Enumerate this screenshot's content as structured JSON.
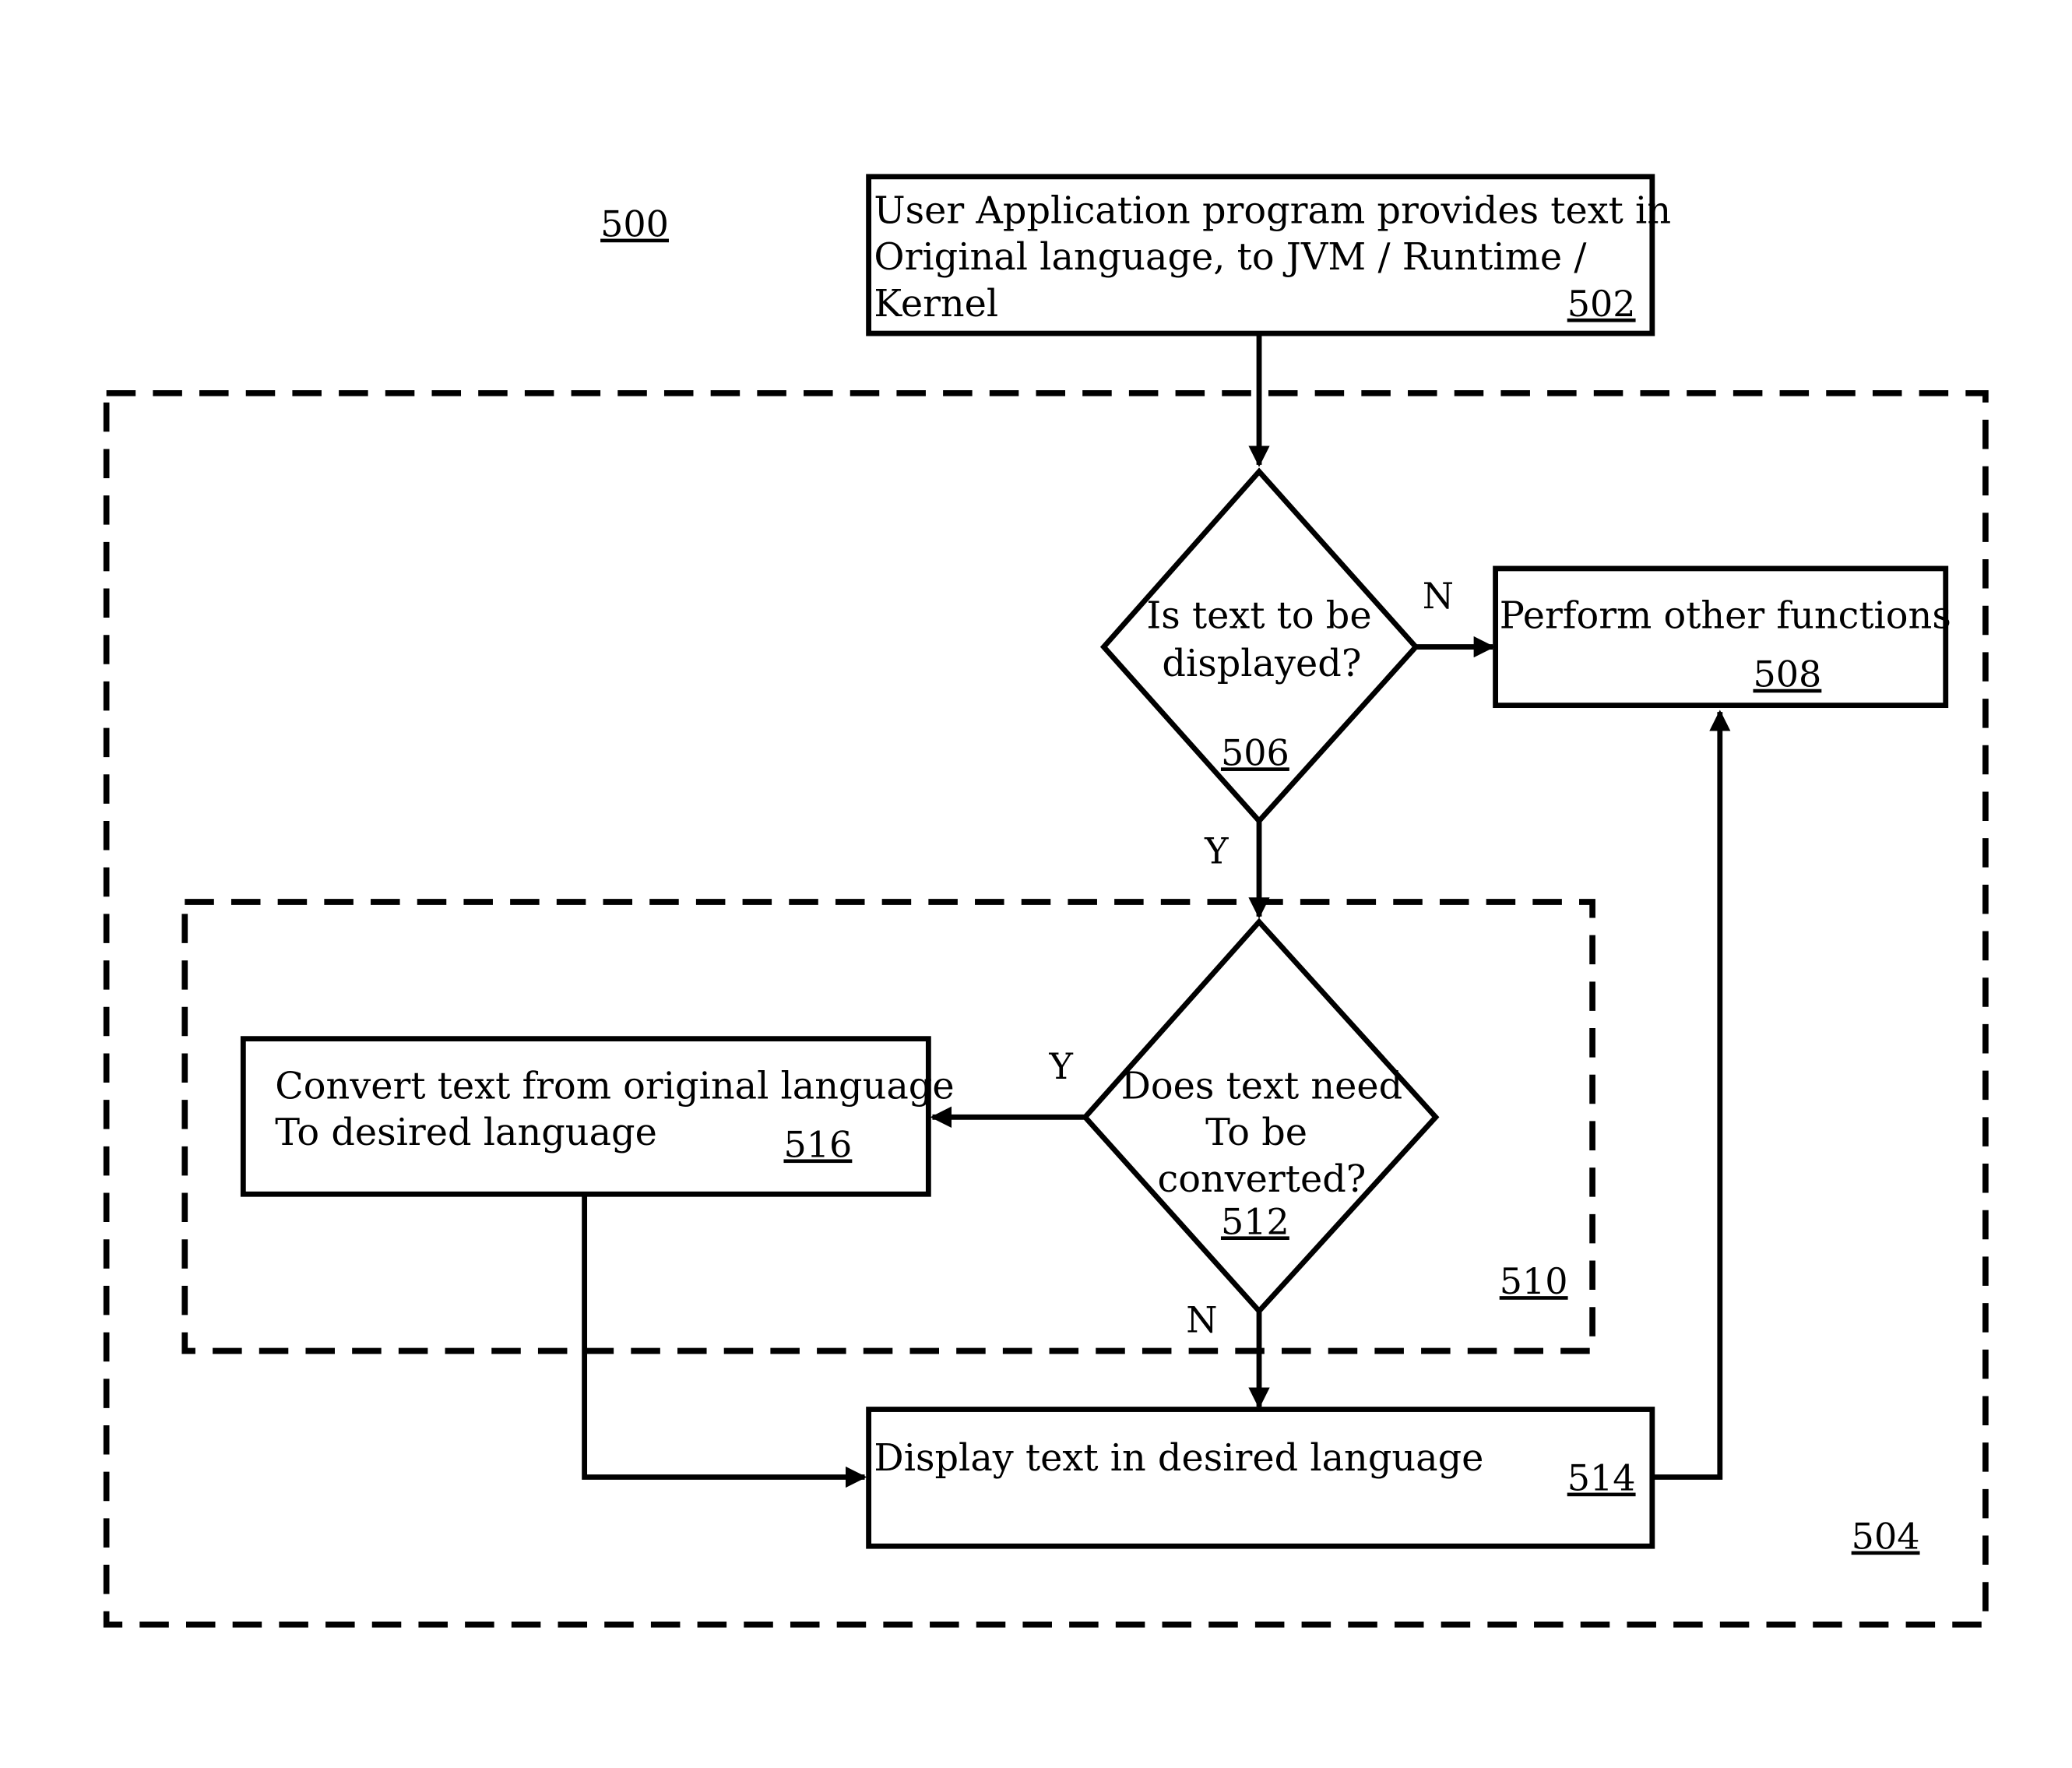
{
  "figure": {
    "label": "500",
    "outer_region_label": "504",
    "inner_region_label": "510"
  },
  "nodes": {
    "n502": {
      "lines": [
        "User Application program provides text in",
        "Original language, to JVM / Runtime /",
        "Kernel"
      ],
      "ref": "502"
    },
    "n506": {
      "lines": [
        "Is text to be",
        "displayed?"
      ],
      "ref": "506"
    },
    "n508": {
      "lines": [
        "Perform other functions"
      ],
      "ref": "508"
    },
    "n512": {
      "lines": [
        "Does text need",
        "To be",
        "converted?"
      ],
      "ref": "512"
    },
    "n514": {
      "lines": [
        "Display text in desired language"
      ],
      "ref": "514"
    },
    "n516": {
      "lines": [
        "Convert text from original language",
        "To desired language"
      ],
      "ref": "516"
    }
  },
  "edges": {
    "e506_508": {
      "label": "N"
    },
    "e506_512": {
      "label": "Y"
    },
    "e512_516": {
      "label": "Y"
    },
    "e512_514": {
      "label": "N"
    }
  }
}
